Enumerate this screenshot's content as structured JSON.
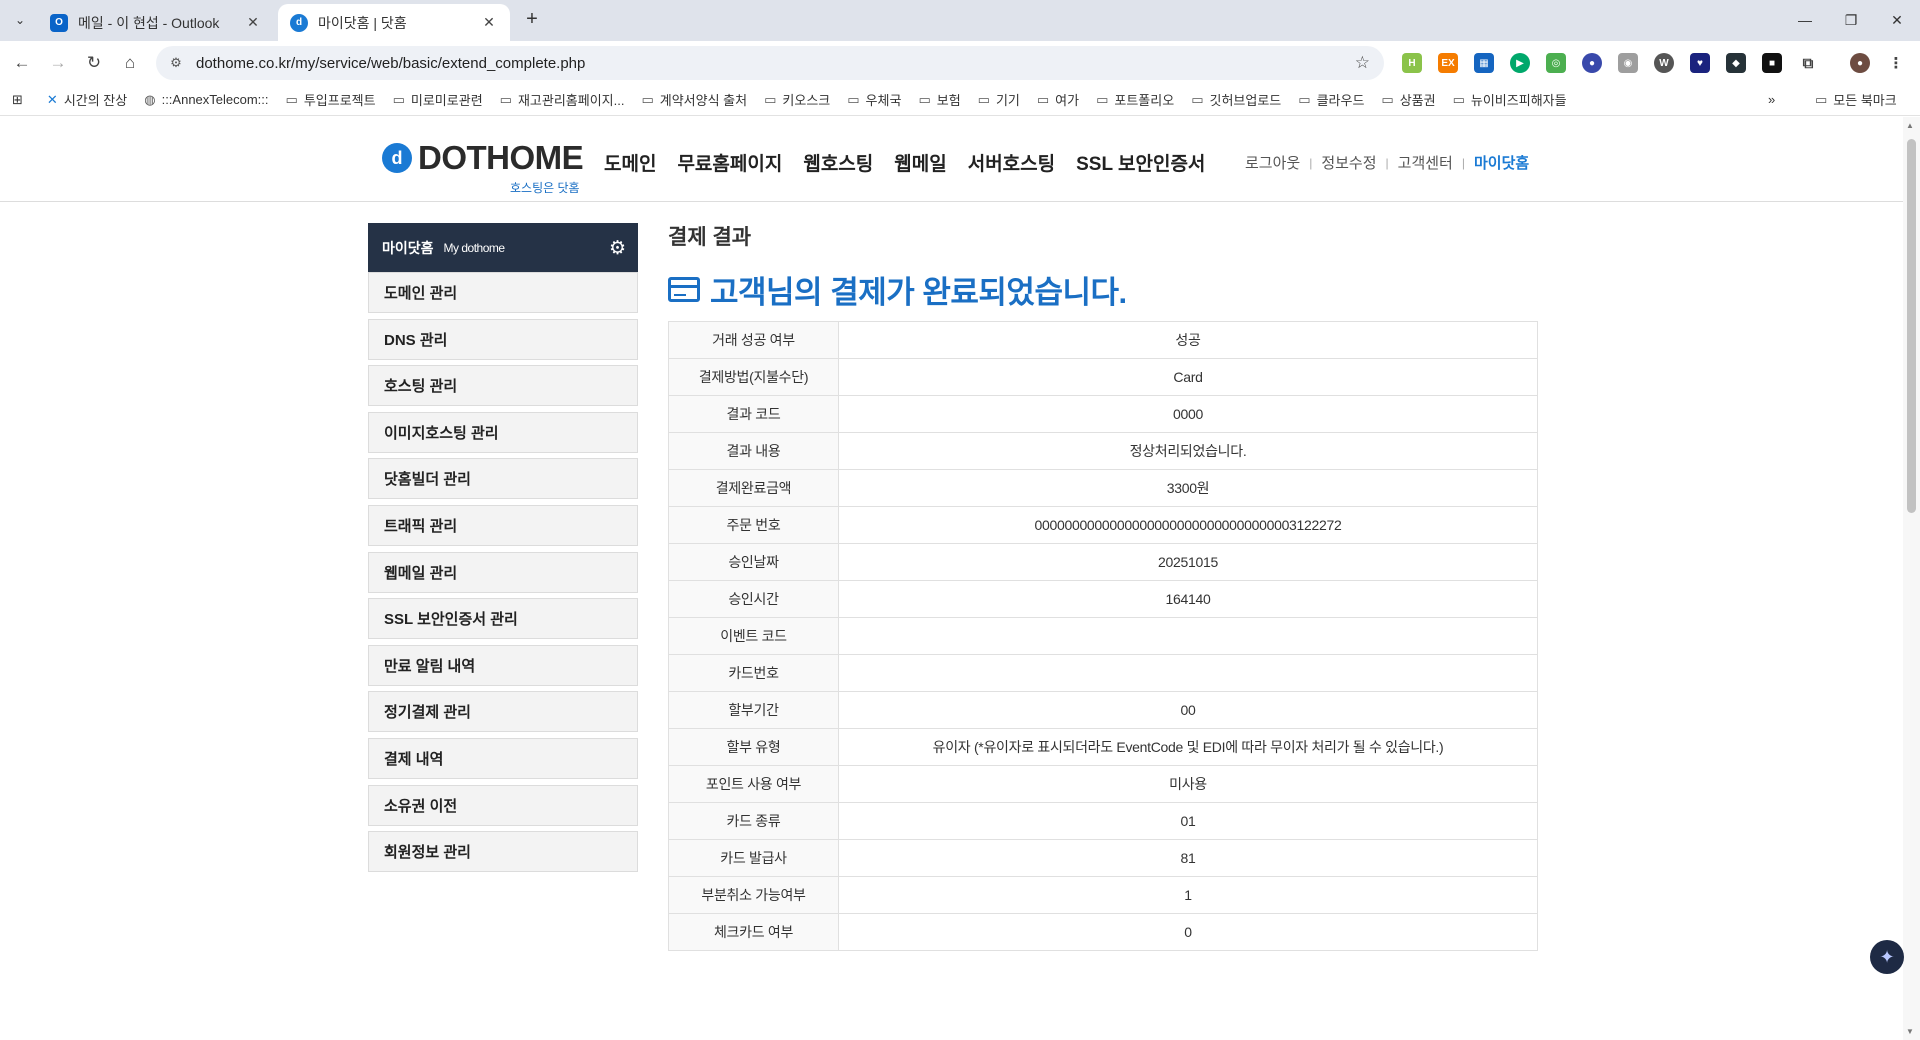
{
  "browser": {
    "tabs": [
      {
        "title": "메일 - 이 현섭 - Outlook",
        "icon": "outlook-icon",
        "active": false
      },
      {
        "title": "마이닷홈 | 닷홈",
        "icon": "dothome-icon",
        "active": true
      }
    ],
    "url": "dothome.co.kr/my/service/web/basic/extend_complete.php",
    "bookmarks": [
      {
        "label": "시간의 잔상",
        "icon": "bookmark-app-icon"
      },
      {
        "label": ":::AnnexTelecom:::",
        "icon": "globe-icon"
      },
      {
        "label": "투입프로젝트",
        "icon": "folder-icon"
      },
      {
        "label": "미로미로관련",
        "icon": "folder-icon"
      },
      {
        "label": "재고관리홈페이지...",
        "icon": "folder-icon"
      },
      {
        "label": "계약서양식 출처",
        "icon": "folder-icon"
      },
      {
        "label": "키오스크",
        "icon": "folder-icon"
      },
      {
        "label": "우체국",
        "icon": "folder-icon"
      },
      {
        "label": "보험",
        "icon": "folder-icon"
      },
      {
        "label": "기기",
        "icon": "folder-icon"
      },
      {
        "label": "여가",
        "icon": "folder-icon"
      },
      {
        "label": "포트폴리오",
        "icon": "folder-icon"
      },
      {
        "label": "깃허브업로드",
        "icon": "folder-icon"
      },
      {
        "label": "클라우드",
        "icon": "folder-icon"
      },
      {
        "label": "상품권",
        "icon": "folder-icon"
      },
      {
        "label": "뉴이비즈피해자들",
        "icon": "folder-icon"
      }
    ],
    "all_bookmarks": "모든 북마크"
  },
  "site": {
    "logo_text": "DOTHOME",
    "logo_tagline": "호스팅은 닷홈",
    "main_nav": [
      "도메인",
      "무료홈페이지",
      "웹호스팅",
      "웹메일",
      "서버호스팅",
      "SSL 보안인증서"
    ],
    "user_nav": [
      "로그아웃",
      "정보수정",
      "고객센터",
      "마이닷홈"
    ]
  },
  "sidebar": {
    "title": "마이닷홈",
    "subtitle": "My dothome",
    "items": [
      "도메인 관리",
      "DNS 관리",
      "호스팅 관리",
      "이미지호스팅 관리",
      "닷홈빌더 관리",
      "트래픽 관리",
      "웹메일 관리",
      "SSL 보안인증서 관리",
      "만료 알림 내역",
      "정기결제 관리",
      "결제 내역",
      "소유권 이전",
      "회원정보 관리"
    ]
  },
  "main": {
    "title": "결제 결과",
    "headline": "고객님의 결제가 완료되었습니다.",
    "rows": [
      {
        "label": "거래 성공 여부",
        "value": "성공"
      },
      {
        "label": "결제방법(지불수단)",
        "value": "Card"
      },
      {
        "label": "결과 코드",
        "value": "0000"
      },
      {
        "label": "결과 내용",
        "value": "정상처리되었습니다."
      },
      {
        "label": "결제완료금액",
        "value": "3300원"
      },
      {
        "label": "주문 번호",
        "value": "00000000000000000000000000000000003122272"
      },
      {
        "label": "승인날짜",
        "value": "20251015"
      },
      {
        "label": "승인시간",
        "value": "164140"
      },
      {
        "label": "이벤트 코드",
        "value": ""
      },
      {
        "label": "카드번호",
        "value": ""
      },
      {
        "label": "할부기간",
        "value": "00"
      },
      {
        "label": "할부 유형",
        "value": "유이자 (*유이자로 표시되더라도 EventCode 및 EDI에 따라 무이자 처리가 될 수 있습니다.)"
      },
      {
        "label": "포인트 사용 여부",
        "value": "미사용"
      },
      {
        "label": "카드 종류",
        "value": "01"
      },
      {
        "label": "카드 발급사",
        "value": "81"
      },
      {
        "label": "부분취소 가능여부",
        "value": "1"
      },
      {
        "label": "체크카드 여부",
        "value": "0"
      }
    ]
  },
  "colors": {
    "accent": "#1a6fc4",
    "sidebar_head": "#253246"
  }
}
